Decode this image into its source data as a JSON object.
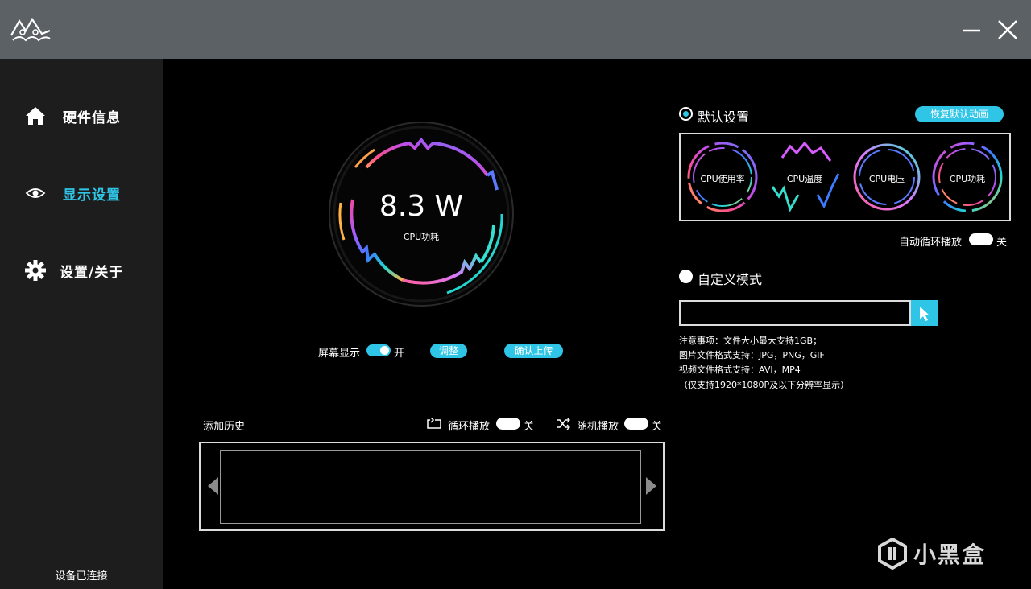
{
  "window": {
    "logo_icon": "mountain-logo-icon",
    "minimize_icon": "minimize-icon",
    "close_icon": "close-icon"
  },
  "sidebar": {
    "items": [
      {
        "label": "硬件信息",
        "icon": "home-icon",
        "active": false
      },
      {
        "label": "显示设置",
        "icon": "eye-icon",
        "active": true
      },
      {
        "label": "设置/关于",
        "icon": "gear-icon",
        "active": false
      }
    ],
    "status": "设备已连接"
  },
  "preview": {
    "value": "8.3 W",
    "label": "CPU功耗"
  },
  "screen_controls": {
    "screen_display_label": "屏幕显示",
    "screen_display_state": "开",
    "adjust_label": "调整",
    "upload_label": "确认上传"
  },
  "history": {
    "title": "添加历史",
    "loop_label": "循环播放",
    "loop_state": "关",
    "shuffle_label": "随机播放",
    "shuffle_state": "关"
  },
  "default_settings": {
    "title": "默认设置",
    "restore_label": "恢复默认动画",
    "presets": [
      "CPU使用率",
      "CPU温度",
      "CPU电压",
      "CPU功耗"
    ],
    "auto_loop_label": "自动循环播放",
    "auto_loop_state": "关"
  },
  "custom_mode": {
    "title": "自定义模式",
    "file_value": "",
    "notes": [
      "注意事项：文件大小最大支持1GB；",
      "图片文件格式支持：JPG，PNG，GIF",
      "视频文件格式支持：AVI，MP4",
      "（仅支持1920*1080P及以下分辨率显示）"
    ]
  },
  "watermark": {
    "text": "小黑盒"
  },
  "colors": {
    "accent": "#2fc5e6",
    "titlebar": "#5b6164",
    "sidebar": "#1d1d1d",
    "background": "#000000"
  }
}
